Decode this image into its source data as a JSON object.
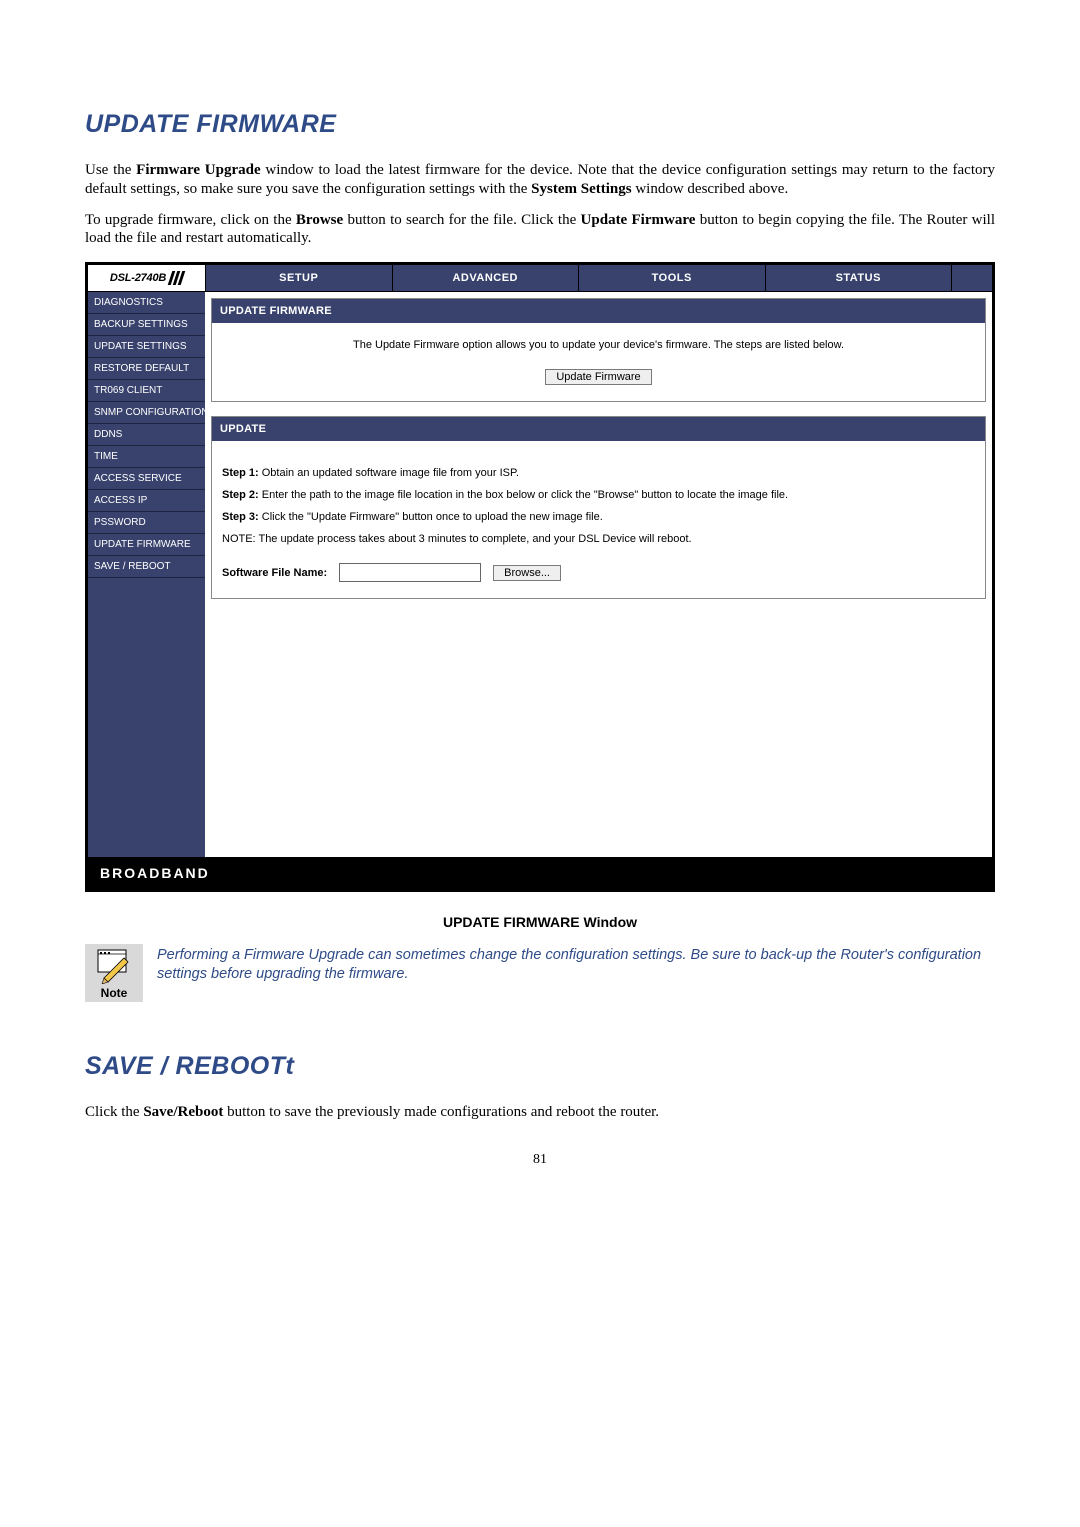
{
  "heading1": "UPDATE FIRMWARE",
  "para1_prefix": "Use the ",
  "para1_b1": "Firmware Upgrade",
  "para1_mid": " window to load the latest firmware for the device. Note that the device configuration settings may return to the factory default settings, so make sure you save the configuration settings with the ",
  "para1_b2": "System Settings",
  "para1_suffix": " window described above.",
  "para2_prefix": "To upgrade firmware, click on the ",
  "para2_b1": "Browse",
  "para2_mid": " button to search for the file. Click the ",
  "para2_b2": "Update Firmware",
  "para2_suffix": " button to begin copying the file. The Router will load the file and restart automatically.",
  "router": {
    "model": "DSL-2740B",
    "tabs": [
      "SETUP",
      "ADVANCED",
      "TOOLS",
      "STATUS"
    ],
    "side": [
      "DIAGNOSTICS",
      "BACKUP SETTINGS",
      "UPDATE SETTINGS",
      "RESTORE DEFAULT",
      "TR069 CLIENT",
      "SNMP CONFIGURATION",
      "DDNS",
      "TIME",
      "ACCESS SERVICE",
      "ACCESS IP",
      "PSSWORD",
      "UPDATE FIRMWARE",
      "SAVE / REBOOT"
    ],
    "panel1": {
      "title": "UPDATE FIRMWARE",
      "desc": "The Update Firmware option allows you to update your device's firmware. The steps are listed below.",
      "button": "Update Firmware"
    },
    "panel2": {
      "title": "UPDATE",
      "s1b": "Step 1:",
      "s1": " Obtain an updated software image file from your ISP.",
      "s2b": "Step 2:",
      "s2": " Enter the path to the image file location in the box below or click the \"Browse\" button to locate the image file.",
      "s3b": "Step 3:",
      "s3": " Click the \"Update Firmware\" button once to upload the new image file.",
      "note": "NOTE: The update process takes about 3 minutes to complete, and your DSL Device will reboot.",
      "fileLabel": "Software File Name:",
      "browse": "Browse..."
    },
    "footer": "BROADBAND"
  },
  "caption": "UPDATE FIRMWARE Window",
  "noteLabel": "Note",
  "noteText": "Performing a Firmware Upgrade can sometimes change the configuration settings. Be sure to back-up the Router's configuration settings before upgrading the firmware.",
  "heading2": "SAVE / REBOOTt",
  "para3_prefix": "Click the ",
  "para3_b1": "Save/Reboot",
  "para3_suffix": " button to save the previously made configurations and reboot the router.",
  "pageNumber": "81"
}
